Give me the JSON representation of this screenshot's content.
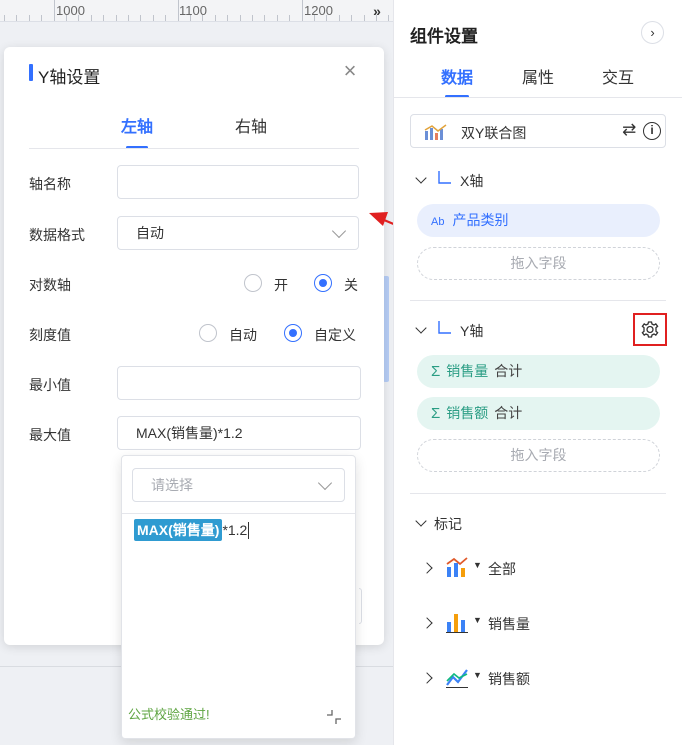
{
  "ruler": {
    "ticks": [
      "1000",
      "1100",
      "1200"
    ],
    "more_icon": "double-chevron-right-icon"
  },
  "dialog": {
    "title": "Y轴设置",
    "close_icon": "close-icon",
    "tabs": [
      {
        "label": "左轴",
        "active": true
      },
      {
        "label": "右轴",
        "active": false
      }
    ],
    "fields": {
      "axis_name": {
        "label": "轴名称",
        "value": ""
      },
      "data_format": {
        "label": "数据格式",
        "value": "自动"
      },
      "log_axis": {
        "label": "对数轴",
        "options": [
          "开",
          "关"
        ],
        "selected": "关"
      },
      "scale": {
        "label": "刻度值",
        "options": [
          "自动",
          "自定义"
        ],
        "selected": "自定义"
      },
      "min": {
        "label": "最小值",
        "value": ""
      },
      "max": {
        "label": "最大值",
        "value": "MAX(销售量)*1.2"
      }
    }
  },
  "formula_popup": {
    "placeholder": "请选择",
    "formula_chip": "MAX(销售量)",
    "formula_rest": "*1.2",
    "status": "公式校验通过!"
  },
  "panel": {
    "title": "组件设置",
    "tabs": [
      {
        "label": "数据",
        "active": true
      },
      {
        "label": "属性",
        "active": false
      },
      {
        "label": "交互",
        "active": false
      }
    ],
    "chart_type": "双Y联合图",
    "x_axis": {
      "label": "X轴",
      "fields": [
        {
          "type_glyph": "Ab",
          "name": "产品类别"
        }
      ],
      "drop_hint": "拖入字段"
    },
    "y_axis": {
      "label": "Y轴",
      "fields": [
        {
          "name": "销售量",
          "agg": "合计"
        },
        {
          "name": "销售额",
          "agg": "合计"
        }
      ],
      "drop_hint": "拖入字段"
    },
    "marks": {
      "label": "标记",
      "items": [
        {
          "name": "全部",
          "icon": "combo-chart-icon"
        },
        {
          "name": "销售量",
          "icon": "bar-chart-icon"
        },
        {
          "name": "销售额",
          "icon": "line-chart-icon"
        }
      ]
    }
  },
  "colors": {
    "accent": "#3370ff",
    "highlight": "#e02020",
    "measure_bg": "#e4f5f1",
    "dim_bg": "#e9effd",
    "ok": "#5ea441"
  }
}
